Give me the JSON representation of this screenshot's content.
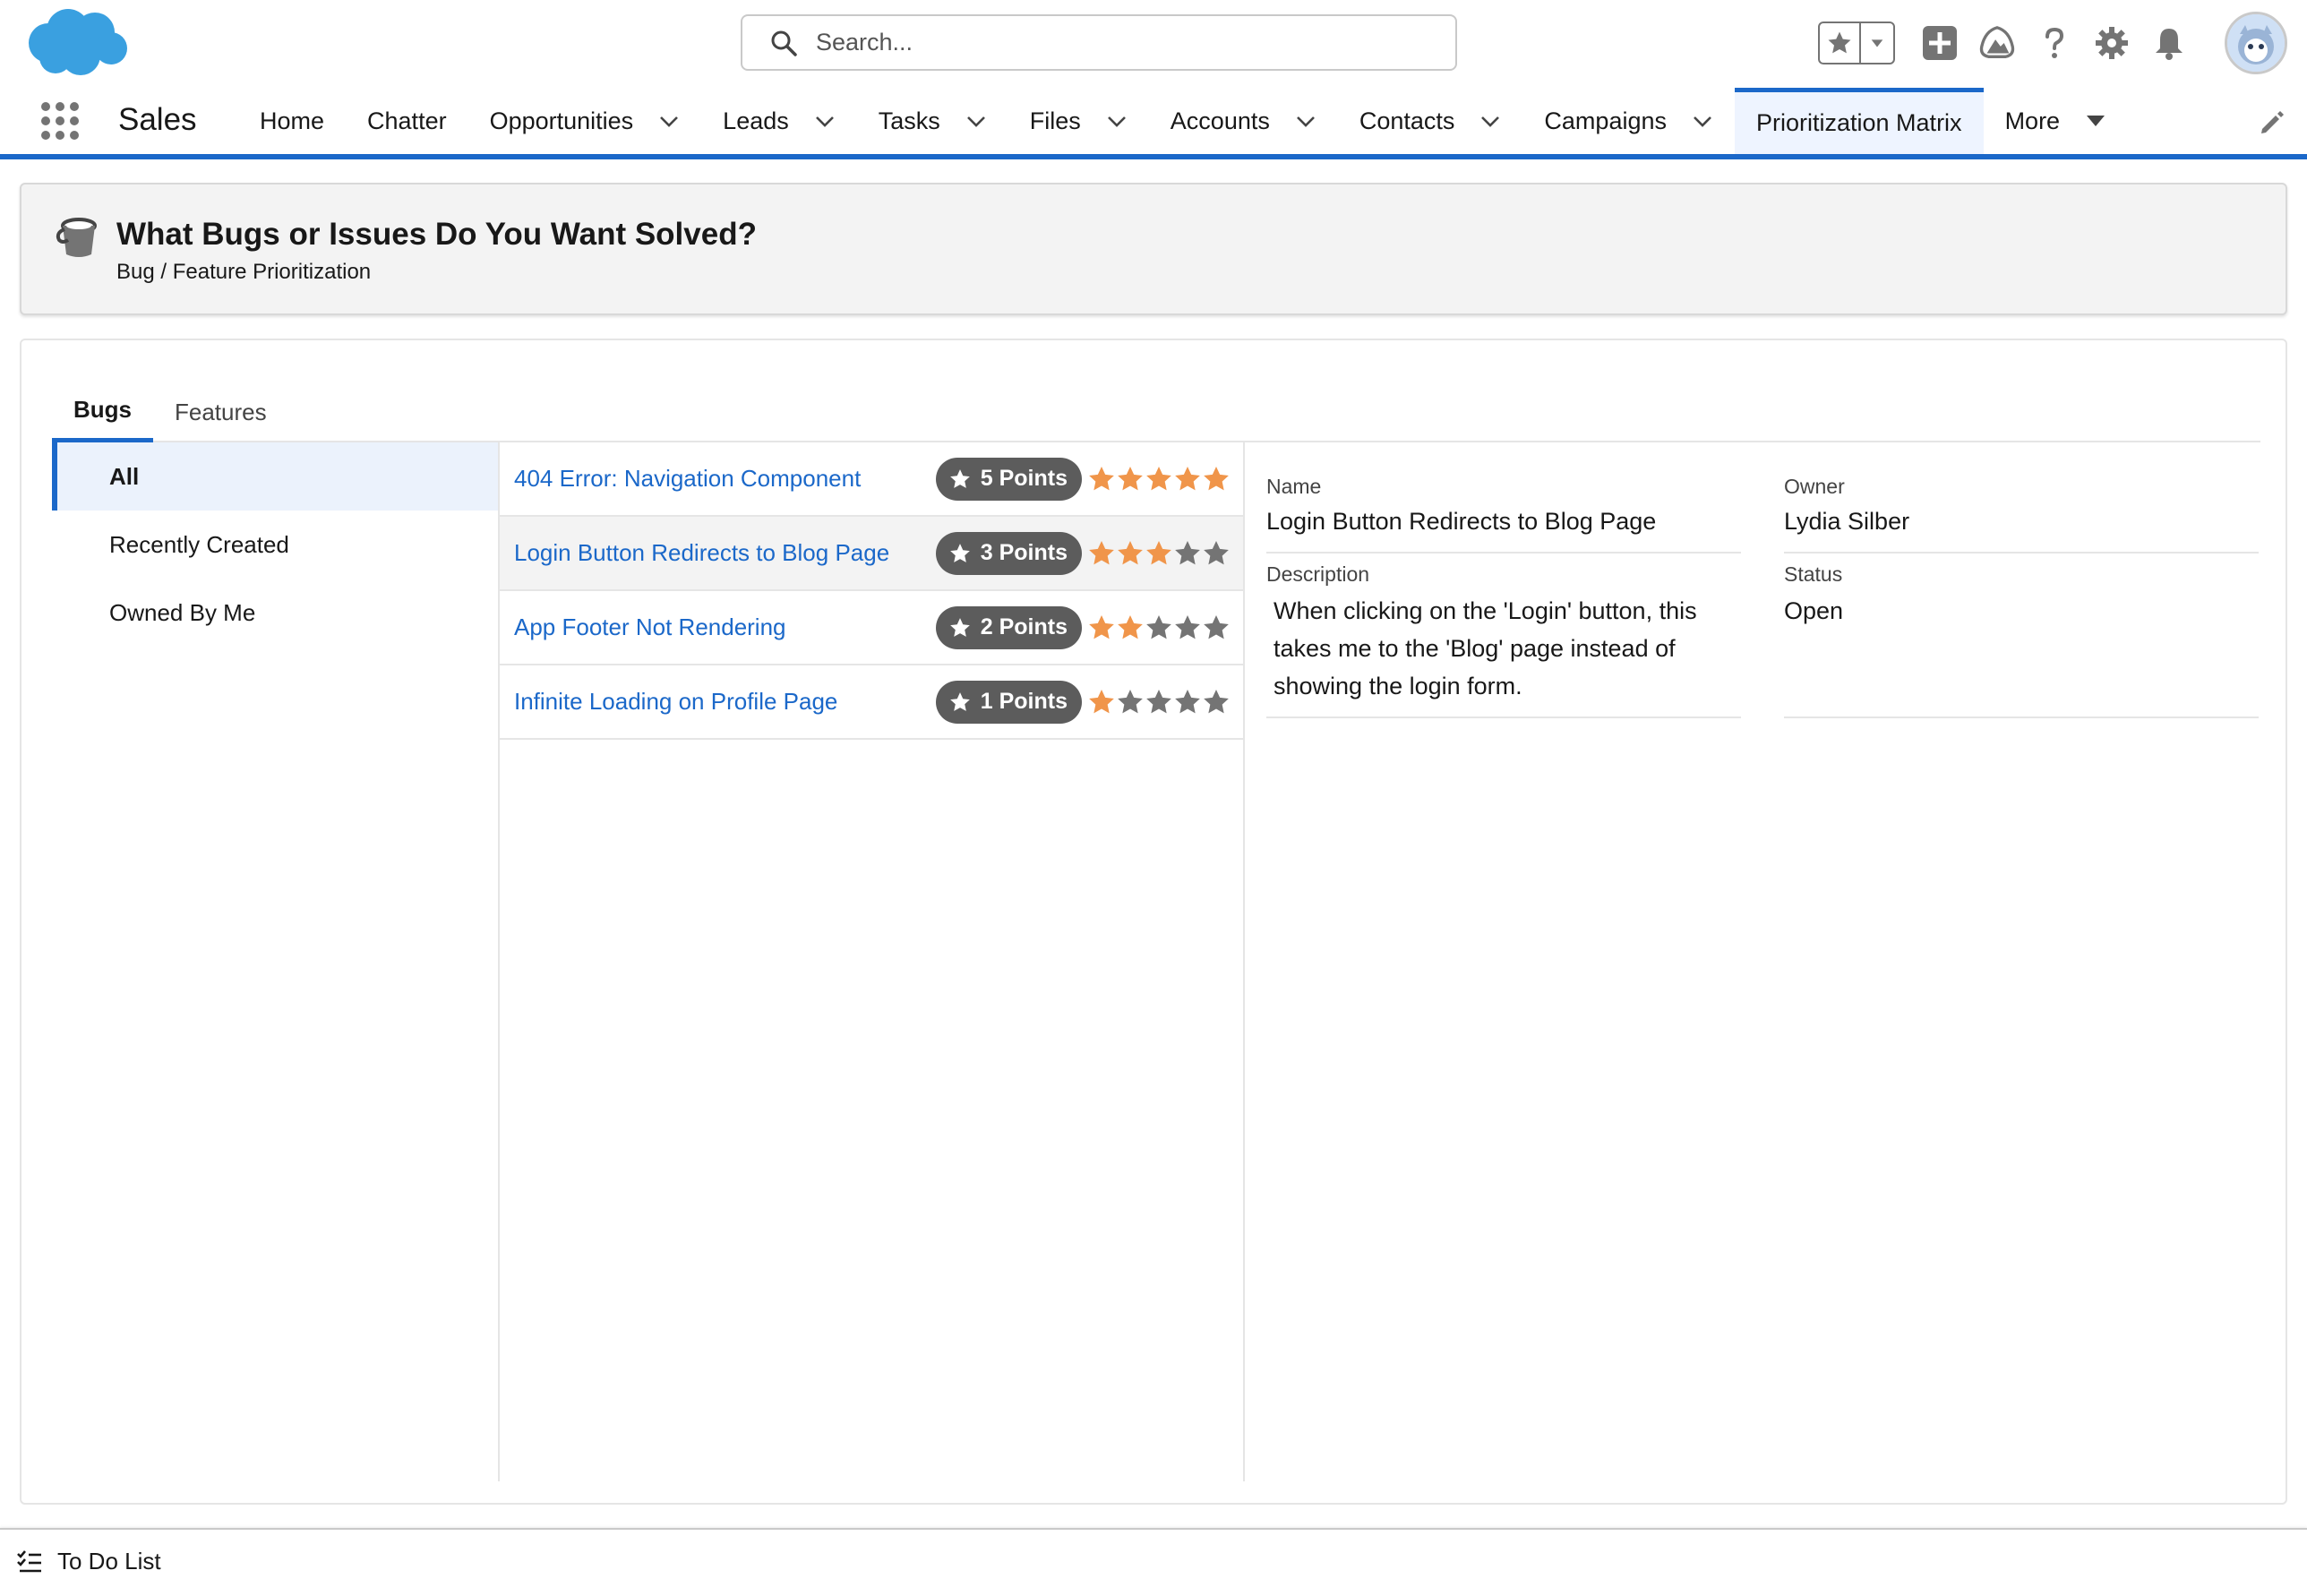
{
  "header": {
    "search": {
      "placeholder": "Search..."
    },
    "icons": [
      "salesforce-cloud-logo",
      "search-icon",
      "favorites-star-icon",
      "favorites-dropdown-icon",
      "global-add-icon",
      "trailhead-icon",
      "help-icon",
      "setup-gear-icon",
      "notification-bell-icon",
      "user-avatar"
    ]
  },
  "nav": {
    "app_name": "Sales",
    "items": [
      {
        "label": "Home",
        "has_menu": false
      },
      {
        "label": "Chatter",
        "has_menu": false
      },
      {
        "label": "Opportunities",
        "has_menu": true
      },
      {
        "label": "Leads",
        "has_menu": true
      },
      {
        "label": "Tasks",
        "has_menu": true
      },
      {
        "label": "Files",
        "has_menu": true
      },
      {
        "label": "Accounts",
        "has_menu": true
      },
      {
        "label": "Contacts",
        "has_menu": true
      },
      {
        "label": "Campaigns",
        "has_menu": true
      },
      {
        "label": "Prioritization Matrix",
        "has_menu": false,
        "active": true
      },
      {
        "label": "More",
        "has_menu": true
      }
    ]
  },
  "page_header": {
    "title": "What Bugs or Issues Do You Want Solved?",
    "subtitle": "Bug / Feature Prioritization"
  },
  "tabs": [
    {
      "label": "Bugs",
      "active": true
    },
    {
      "label": "Features",
      "active": false
    }
  ],
  "filters": [
    {
      "label": "All",
      "active": true
    },
    {
      "label": "Recently Created",
      "active": false
    },
    {
      "label": "Owned By Me",
      "active": false
    }
  ],
  "records": [
    {
      "name": "404 Error: Navigation Component",
      "points_label": "5 Points",
      "rating": 5,
      "selected": false
    },
    {
      "name": "Login Button Redirects to Blog Page",
      "points_label": "3 Points",
      "rating": 3,
      "selected": true
    },
    {
      "name": "App Footer Not Rendering",
      "points_label": "2 Points",
      "rating": 2,
      "selected": false
    },
    {
      "name": "Infinite Loading on Profile Page",
      "points_label": "1 Points",
      "rating": 1,
      "selected": false
    }
  ],
  "detail": {
    "name_label": "Name",
    "name_value": "Login Button Redirects to Blog Page",
    "owner_label": "Owner",
    "owner_value": "Lydia Silber",
    "description_label": "Description",
    "description_value": "When clicking on the 'Login' button, this takes me to the 'Blog' page instead of showing the login form.",
    "status_label": "Status",
    "status_value": "Open"
  },
  "utility_bar": {
    "todo_label": "To Do List"
  },
  "colors": {
    "brand_blue": "#1b68c9",
    "link_blue": "#1b68c9",
    "star_filled": "#f0954a",
    "star_empty": "#747474",
    "badge_bg": "#5c5c5c",
    "logo_blue": "#1798c1"
  }
}
